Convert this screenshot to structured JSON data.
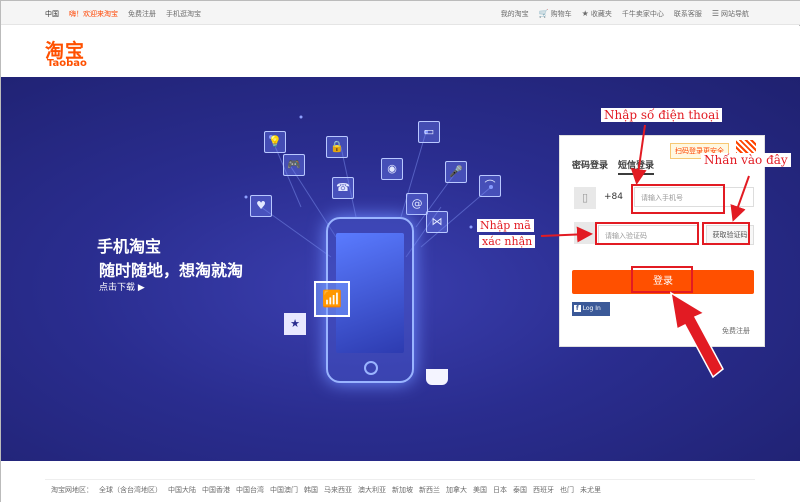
{
  "topbar": {
    "region": "中国",
    "welcome": "嗨！欢迎来淘宝",
    "free_register": "免费注册",
    "mobile": "手机逛淘宝",
    "my_taobao": "我的淘宝",
    "cart": "购物车",
    "favorites": "收藏夹",
    "seller_center": "千牛卖家中心",
    "contact": "联系客服",
    "sitemap": "网站导航"
  },
  "logo": {
    "cn": "淘宝",
    "en": "Taobao"
  },
  "banner": {
    "line1": "手机淘宝",
    "line2": "随时随地，想淘就淘",
    "line3": "点击下载 ▶"
  },
  "login": {
    "tab_password": "密码登录",
    "tab_sms": "短信登录",
    "safe_tip": "扫码登录更安全",
    "country_code": "+84",
    "phone_placeholder": "请输入手机号",
    "code_placeholder": "请输入验证码",
    "get_code": "获取验证码",
    "submit": "登录",
    "facebook": "Log In",
    "register": "免费注册"
  },
  "annotations": {
    "phone": "Nhập số điện thoại",
    "click": "Nhấn vào đây",
    "code_line1": "Nhập mã",
    "code_line2": "xác nhận"
  },
  "footer": {
    "label": "淘宝网地区：",
    "sites": [
      "全球（含台湾地区）",
      "中国大陆",
      "中国香港",
      "中国台湾",
      "中国澳门",
      "韩国",
      "马来西亚",
      "澳大利亚",
      "新加坡",
      "新西兰",
      "加拿大",
      "美国",
      "日本",
      "泰国",
      "西班牙",
      "也门",
      "未尤里"
    ]
  }
}
